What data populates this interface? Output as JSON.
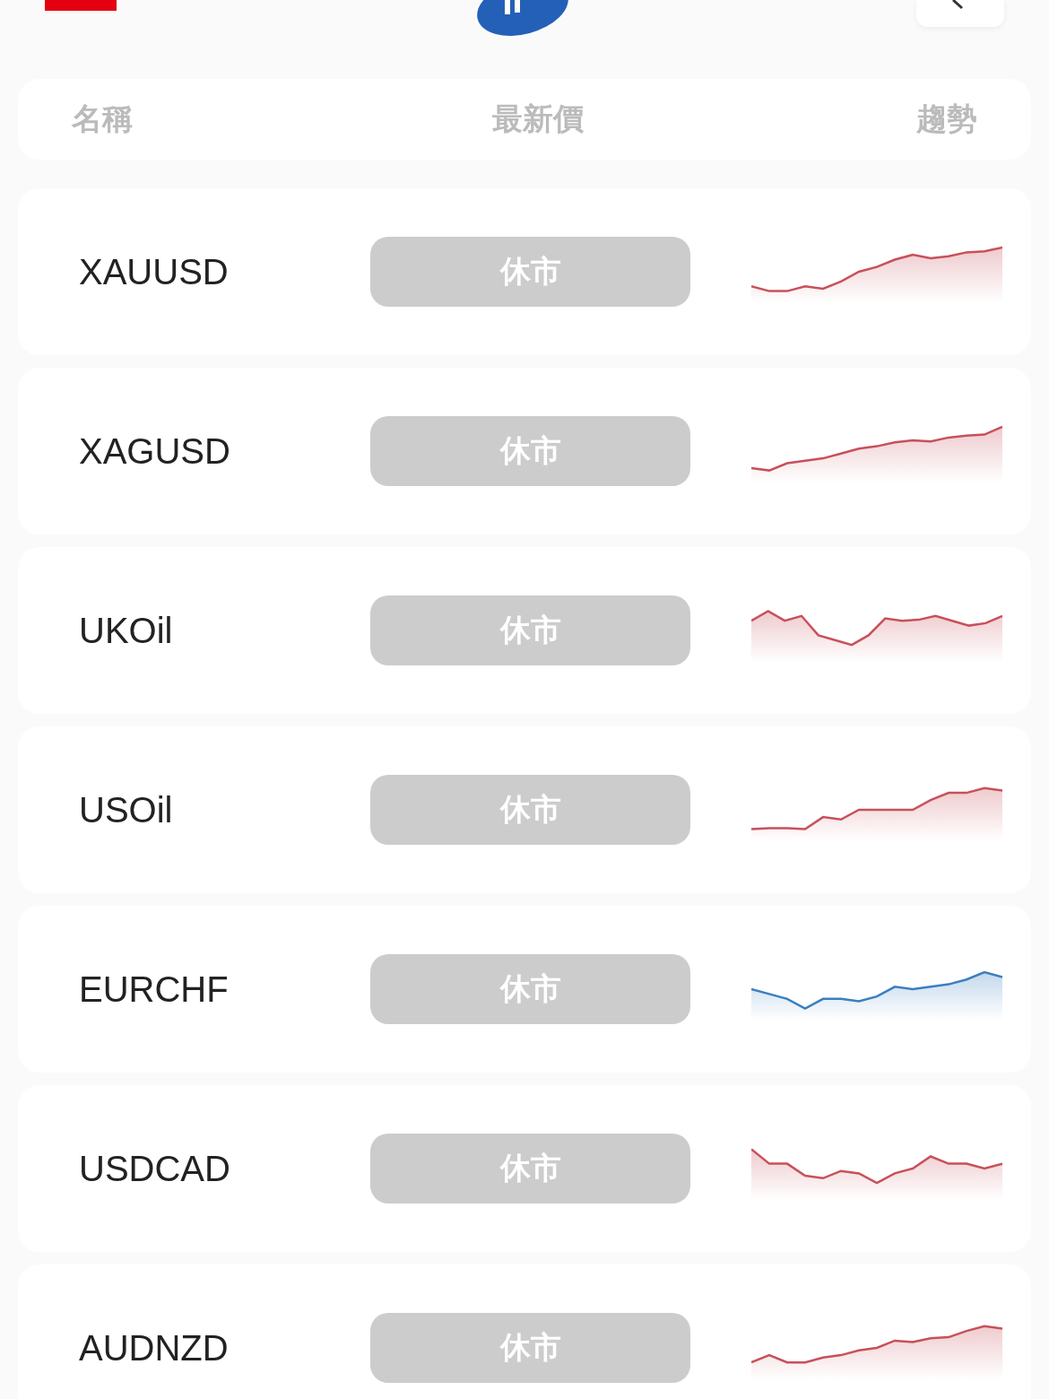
{
  "header": {
    "columns": [
      "名稱",
      "最新價",
      "趨勢"
    ]
  },
  "rows": [
    {
      "symbol": "XAUUSD",
      "price": "休市",
      "color": "#c8505a"
    },
    {
      "symbol": "XAGUSD",
      "price": "休市",
      "color": "#c8505a"
    },
    {
      "symbol": "UKOil",
      "price": "休市",
      "color": "#c8505a"
    },
    {
      "symbol": "USOil",
      "price": "休市",
      "color": "#c8505a"
    },
    {
      "symbol": "EURCHF",
      "price": "休市",
      "color": "#3a7fc0"
    },
    {
      "symbol": "USDCAD",
      "price": "休市",
      "color": "#c8505a"
    },
    {
      "symbol": "AUDNZD",
      "price": "休市",
      "color": "#c8505a"
    }
  ]
}
